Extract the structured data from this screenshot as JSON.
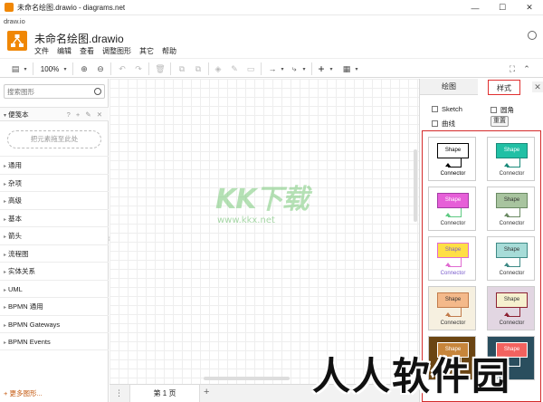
{
  "window": {
    "title": "未命名绘图.drawio - diagrams.net",
    "minimize": "—",
    "maximize": "☐",
    "close": "✕"
  },
  "url": "draw.io",
  "app": {
    "doc_title": "未命名绘图.drawio",
    "menu": [
      "文件",
      "编辑",
      "查看",
      "调整图形",
      "其它",
      "帮助"
    ]
  },
  "toolbar": {
    "zoom": "100%",
    "icons": [
      "format-panel-icon",
      "zoom-dropdown-icon",
      "zoom-in-icon",
      "zoom-out-icon",
      "undo-icon",
      "redo-icon",
      "delete-icon",
      "to-front-icon",
      "to-back-icon",
      "fill-color-icon",
      "line-color-icon",
      "shadow-icon",
      "connection-icon",
      "waypoints-icon",
      "insert-icon",
      "table-icon",
      "fullscreen-icon",
      "collapse-icon"
    ]
  },
  "sidebar": {
    "search_placeholder": "搜索图形",
    "scratchpad": "便笺本",
    "scratchpad_icons": "? + ✎ ✕",
    "drop_hint": "把元素拖至此处",
    "categories": [
      "通用",
      "杂项",
      "高级",
      "基本",
      "箭头",
      "流程图",
      "实体关系",
      "UML",
      "BPMN 通用",
      "BPMN Gateways",
      "BPMN Events"
    ],
    "more_shapes": "+ 更多图形..."
  },
  "pages": {
    "current": "第 1 页",
    "add": "+",
    "menu": "⋮"
  },
  "format_panel": {
    "tabs": [
      "绘图",
      "样式"
    ],
    "close": "✕",
    "sketch": "Sketch",
    "rounded": "圆角",
    "curved": "曲线",
    "reset": "重置",
    "styles": [
      {
        "shape_label": "Shape",
        "connector_label": "Connector",
        "fill": "#ffffff",
        "stroke": "#000000",
        "font": "#000000",
        "bg": "#ffffff",
        "conn": "#000000"
      },
      {
        "shape_label": "Shape",
        "connector_label": "Connector",
        "fill": "#21c0a5",
        "stroke": "#1a8a7a",
        "font": "#ffffff",
        "bg": "#ffffff",
        "conn": "#1a8a7a"
      },
      {
        "shape_label": "Shape",
        "connector_label": "Connector",
        "fill": "#e65fd8",
        "stroke": "#a33da5",
        "font": "#ffffff",
        "bg": "#ffffff",
        "conn": "#5fca83"
      },
      {
        "shape_label": "Shape",
        "connector_label": "Connector",
        "fill": "#a8c49f",
        "stroke": "#6b8a63",
        "font": "#333333",
        "bg": "#ffffff",
        "conn": "#6b8a63"
      },
      {
        "shape_label": "Shape",
        "connector_label": "Connector",
        "fill": "#ffdf45",
        "stroke": "#e06bd1",
        "font": "#7a5ccc",
        "bg": "#ffffff",
        "conn": "#e06bd1"
      },
      {
        "shape_label": "Shape",
        "connector_label": "Connector",
        "fill": "#a7dcd8",
        "stroke": "#3f8a86",
        "font": "#333333",
        "bg": "#ffffff",
        "conn": "#3f8a86"
      },
      {
        "shape_label": "Shape",
        "connector_label": "Connector",
        "fill": "#f4b98a",
        "stroke": "#c27c4c",
        "font": "#333333",
        "bg": "#f6f0e0",
        "conn": "#c27c4c"
      },
      {
        "shape_label": "Shape",
        "connector_label": "Connector",
        "fill": "#f6f1cf",
        "stroke": "#8c2233",
        "font": "#333333",
        "bg": "#e2d6e2",
        "conn": "#8c2233"
      },
      {
        "shape_label": "Shape",
        "connector_label": "",
        "fill": "#c7853b",
        "stroke": "#ffffff",
        "font": "#ffffff",
        "bg": "#6b4513",
        "conn": "#ffffff"
      },
      {
        "shape_label": "Shape",
        "connector_label": "",
        "fill": "#f2625f",
        "stroke": "#ffffff",
        "font": "#ffffff",
        "bg": "#2a4e5e",
        "conn": "#ffffff"
      }
    ]
  },
  "watermarks": {
    "logo_text": "KK下载",
    "url_text": "www.kkx.net",
    "corner_text": "人人软件园"
  },
  "colors": {
    "accent": "#f08705",
    "highlight": "#d42b2b"
  }
}
